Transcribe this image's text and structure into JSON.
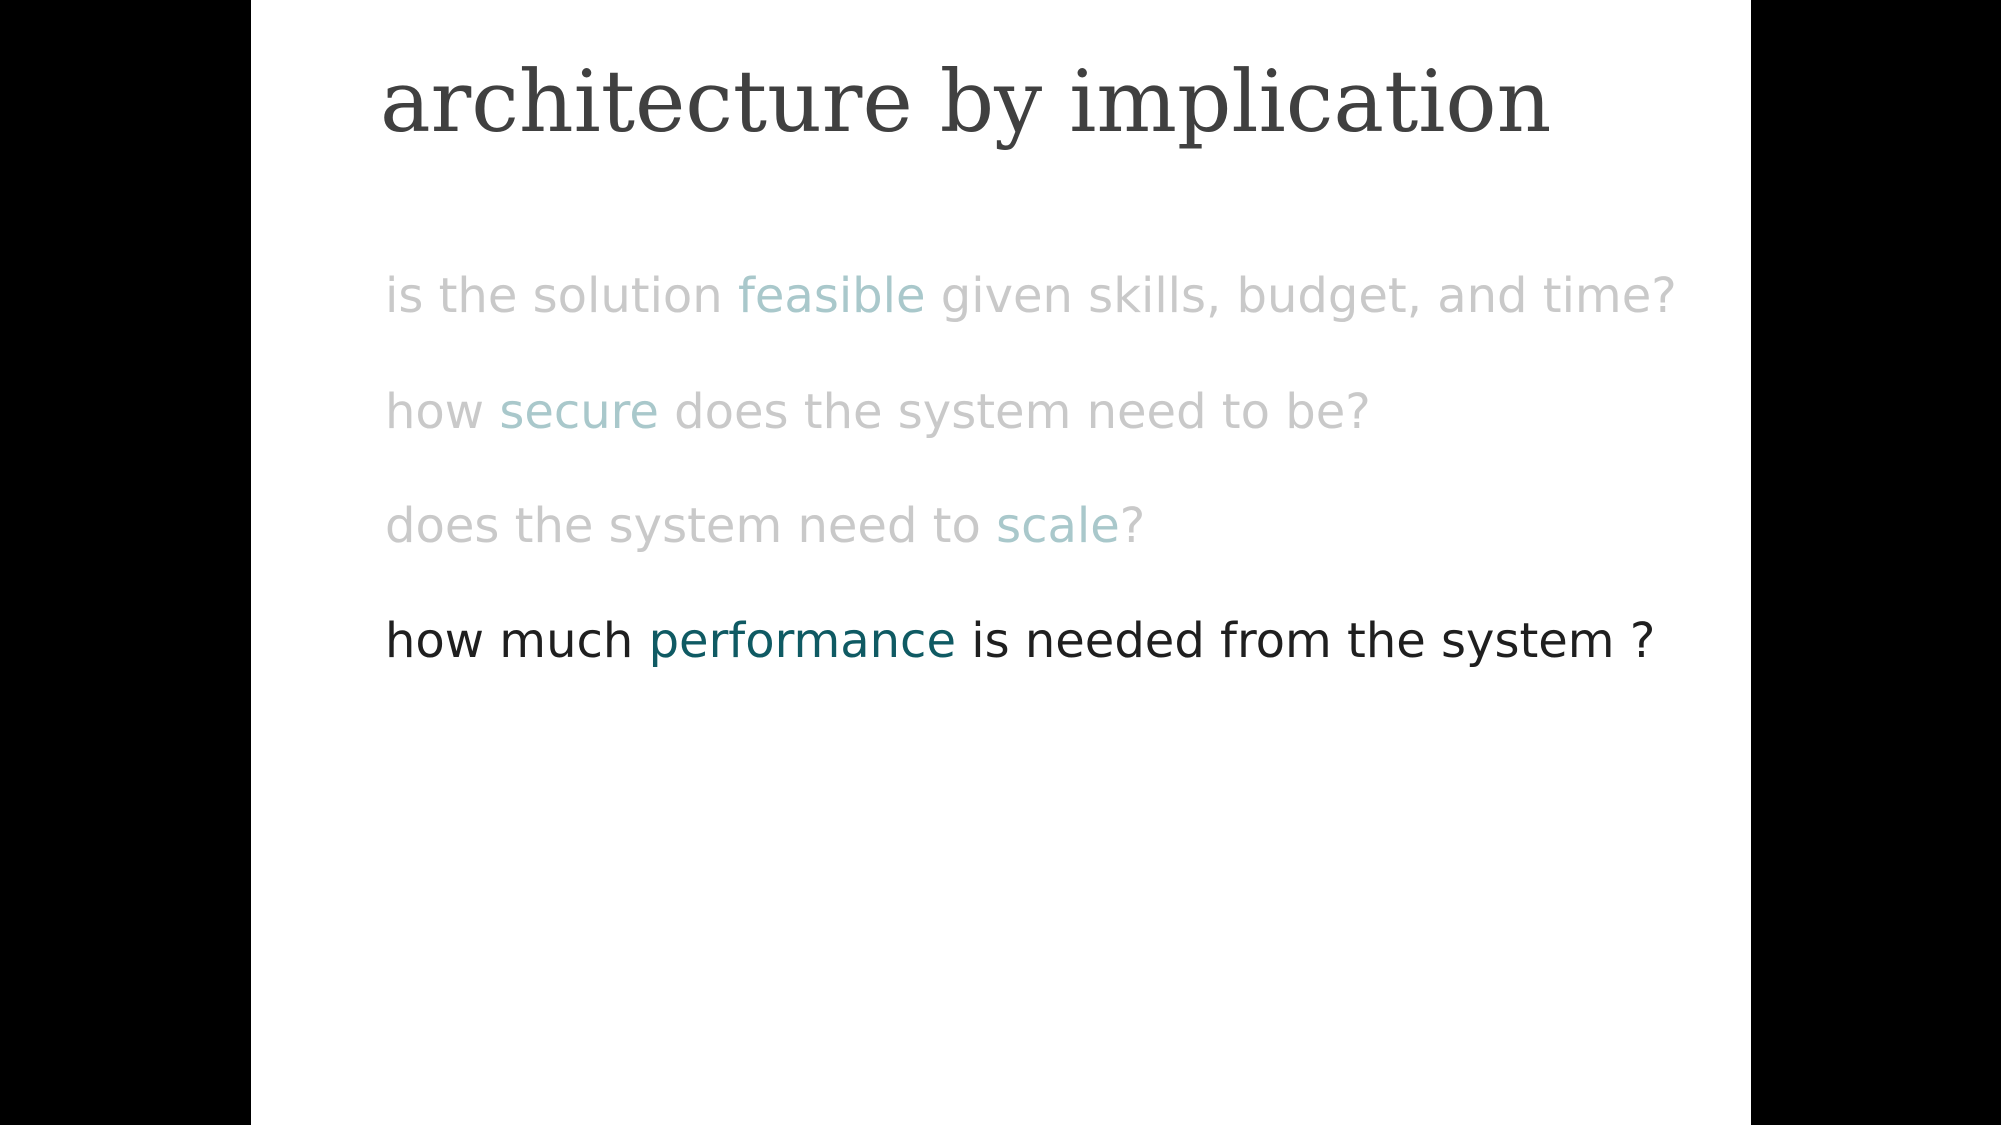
{
  "slide": {
    "title": "architecture by implication",
    "questions": [
      {
        "before": "is the solution ",
        "keyword": "feasible",
        "after": " given skills, budget, and time?",
        "state": "dimmed"
      },
      {
        "before": "how ",
        "keyword": "secure",
        "after": " does the system need to be?",
        "state": "dimmed"
      },
      {
        "before": "does the system need to ",
        "keyword": "scale",
        "after": "?",
        "state": "dimmed"
      },
      {
        "before": "how much ",
        "keyword": "performance",
        "after": " is needed from the system ?",
        "state": "active"
      }
    ]
  },
  "colors": {
    "background": "#ffffff",
    "letterbox": "#000000",
    "title": "#404040",
    "dimmed_text": "#c9c9c9",
    "dimmed_keyword": "#a9c8cb",
    "active_text": "#1f1f1f",
    "active_keyword": "#0f5a63"
  }
}
